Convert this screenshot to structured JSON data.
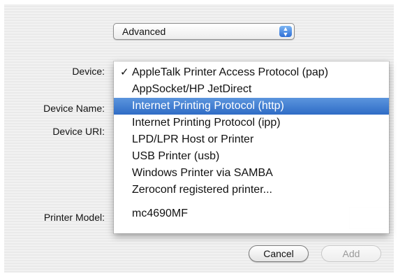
{
  "top_popup": {
    "value": "Advanced"
  },
  "labels": {
    "device": "Device:",
    "device_name": "Device Name:",
    "device_uri": "Device URI:",
    "printer_model": "Printer Model:"
  },
  "device_menu": {
    "checked_index": 0,
    "highlighted_index": 2,
    "items": [
      "AppleTalk Printer Access Protocol (pap)",
      "AppSocket/HP JetDirect",
      "Internet Printing Protocol (http)",
      "Internet Printing Protocol (ipp)",
      "LPD/LPR Host or Printer",
      "USB Printer (usb)",
      "Windows Printer via SAMBA",
      "Zeroconf registered printer..."
    ],
    "extra_item": "mc4690MF",
    "check_glyph": "✓"
  },
  "buttons": {
    "cancel": "Cancel",
    "add": "Add"
  },
  "colors": {
    "highlight": "#3a74cf",
    "default_button_border": "#7a7a7a"
  }
}
